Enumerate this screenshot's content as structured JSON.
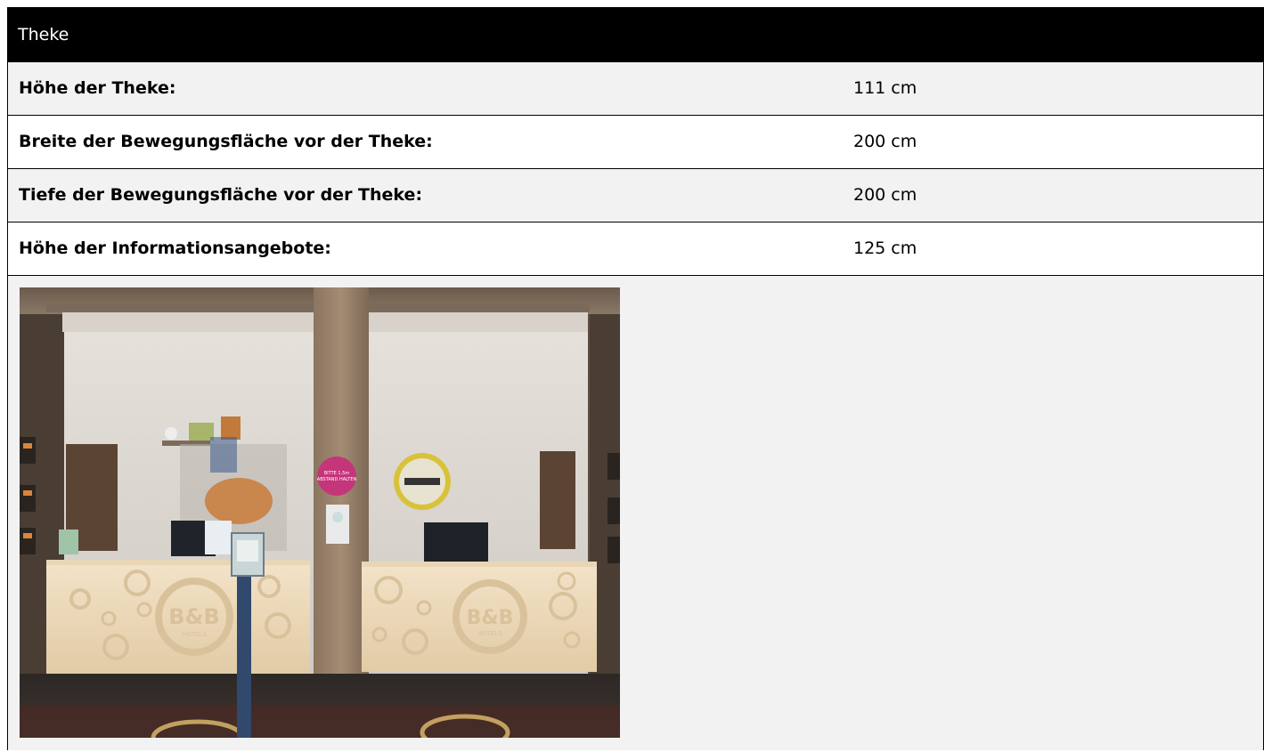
{
  "section": {
    "title": "Theke"
  },
  "rows": [
    {
      "label": "Höhe der Theke:",
      "value": "111 cm"
    },
    {
      "label": "Breite der Bewegungsfläche vor der Theke:",
      "value": "200 cm"
    },
    {
      "label": "Tiefe der Bewegungsfläche vor der Theke:",
      "value": "200 cm"
    },
    {
      "label": "Höhe der Informationsangebote:",
      "value": "125 cm"
    }
  ],
  "photo": {
    "logo_text": "B&B",
    "logo_subtext": "HOTELS",
    "sign_text": "BITTE 1,5m ABSTAND HALTEN"
  }
}
